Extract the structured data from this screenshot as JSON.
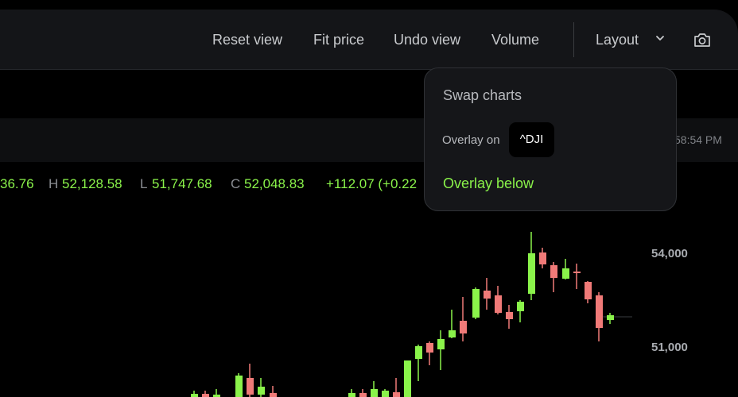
{
  "toolbar": {
    "reset_label": "Reset view",
    "fit_label": "Fit price",
    "undo_label": "Undo view",
    "volume_label": "Volume",
    "layout_label": "Layout",
    "layout_icon": "chevron-down-icon",
    "camera_icon": "camera-icon"
  },
  "infobar": {
    "time": "58:54 PM"
  },
  "ohlc": {
    "open_value": "36.76",
    "high_key": "H",
    "high_value": "52,128.58",
    "low_key": "L",
    "low_value": "51,747.68",
    "close_key": "C",
    "close_value": "52,048.83",
    "change": "+112.07 (+0.22"
  },
  "axis": {
    "upper_label": "54,000",
    "lower_label": "51,000"
  },
  "popup": {
    "title": "Swap charts",
    "overlay_on_label": "Overlay on",
    "symbol": "^DJI",
    "overlay_below_label": "Overlay below"
  },
  "colors": {
    "up": "#8af34a",
    "down": "#f07a78",
    "panel": "#141518"
  }
}
